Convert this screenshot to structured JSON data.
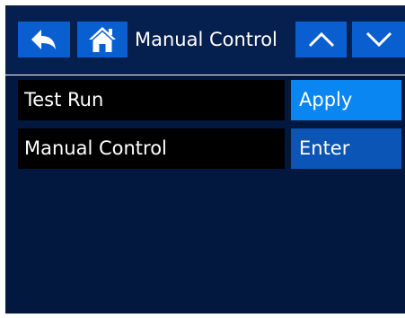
{
  "header": {
    "title": "Manual Control",
    "back_icon": "back-arrow-icon",
    "home_icon": "home-icon",
    "up_icon": "chevron-up-icon",
    "down_icon": "chevron-down-icon"
  },
  "rows": [
    {
      "label": "Test Run",
      "button": "Apply"
    },
    {
      "label": "Manual Control",
      "button": "Enter"
    }
  ],
  "colors": {
    "background": "#03183f",
    "header_background": "#05204f",
    "button_blue": "#0a5fd0",
    "apply_highlight": "#0a86f2",
    "enter_button": "#0a55b5",
    "label_background": "#000000",
    "text": "#ffffff"
  }
}
